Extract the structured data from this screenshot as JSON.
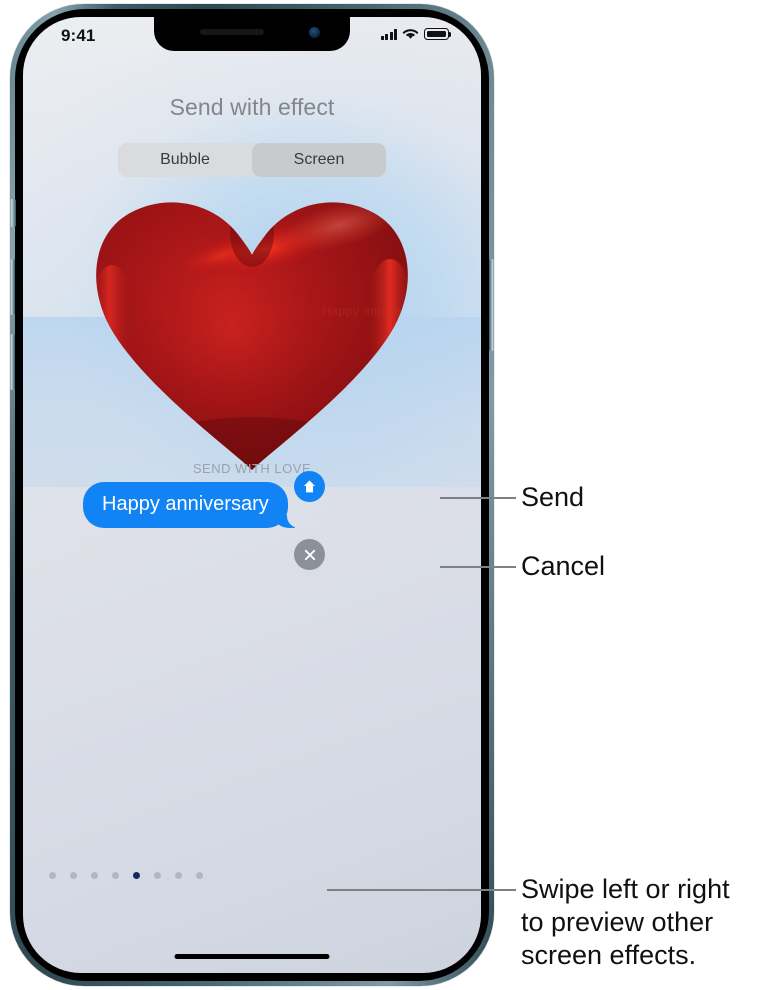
{
  "status_bar": {
    "time": "9:41",
    "cellular_icon": "signal-bars-icon",
    "wifi_icon": "wifi-icon",
    "battery_icon": "battery-icon"
  },
  "sheet": {
    "title": "Send with effect",
    "segments": [
      {
        "label": "Bubble",
        "selected": false
      },
      {
        "label": "Screen",
        "selected": true
      }
    ]
  },
  "preview": {
    "effect_name": "SEND WITH LOVE",
    "balloon_icon": "heart-balloon-graphic",
    "balloon_color": "#a51416"
  },
  "message": {
    "bubble_text": "Happy anniversary",
    "bubble_color": "#1283f5",
    "bubble_text_color": "#ffffff"
  },
  "actions": {
    "send": {
      "icon": "arrow-up-icon",
      "color": "#1283f5"
    },
    "cancel": {
      "icon": "close-x-icon",
      "color": "#8b9099"
    }
  },
  "pagination": {
    "total": 8,
    "active_index": 4,
    "active_color": "#18275c",
    "inactive_color": "#b2b6bf"
  },
  "callouts": [
    {
      "label": "Send"
    },
    {
      "label": "Cancel"
    },
    {
      "label": "Swipe left or right\nto preview other\nscreen effects."
    }
  ]
}
